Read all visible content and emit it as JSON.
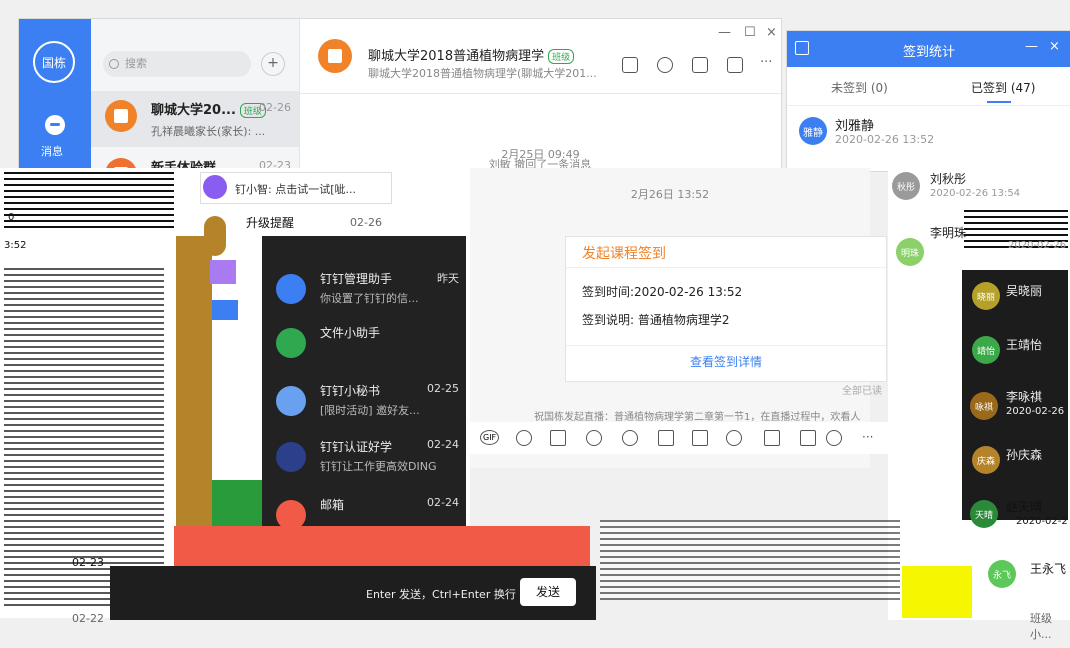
{
  "me": {
    "avatar_text": "国栋",
    "nav_label": "消息"
  },
  "search": {
    "placeholder": "搜索",
    "add": "+"
  },
  "conversations": [
    {
      "name": "聊城大学20...",
      "tag": "班级",
      "time": "02-26",
      "sub": "孔祥晨曦家长(家长): ..."
    },
    {
      "name": "新手体验群",
      "time": "02-23",
      "sub": ""
    }
  ],
  "chat": {
    "title": "聊城大学2018普通植物病理学",
    "tag": "班级",
    "subtitle": "聊城大学2018普通植物病理学(聊城大学201...",
    "sys_time_1": "2月25日 09:49",
    "sys_recall": "刘敏 撤回了一条消息",
    "sys_time_2": "2月26日 13:52",
    "window_min": "—",
    "window_max": "☐",
    "window_close": "×",
    "more": "···"
  },
  "stats": {
    "title": "签到统计",
    "tab_unsigned": "未签到 (0)",
    "tab_signed": "已签到 (47)",
    "min": "—",
    "close": "×",
    "people": [
      {
        "avatar": "雅静",
        "name": "刘雅静",
        "time": "2020-02-26 13:52"
      },
      {
        "avatar": "秋彤",
        "name": "刘秋彤",
        "time": "2020-02-26 13:54"
      },
      {
        "avatar": "明珠",
        "name": "李明珠",
        "time": "2020-02-26"
      }
    ]
  },
  "overlay": {
    "ding_tip": "钉小智: 点击试一试[呲...",
    "upgrade": "升级提醒",
    "upgrade_time": "02-26",
    "dark_items": [
      {
        "name": "钉钉管理助手",
        "time": "昨天",
        "sub": "你设置了钉钉的信..."
      },
      {
        "name": "文件小助手",
        "time": "",
        "sub": ""
      },
      {
        "name": "钉钉小秘书",
        "time": "02-25",
        "sub": "[限时活动] 邀好友..."
      },
      {
        "name": "钉钉认证好学",
        "time": "02-24",
        "sub": "钉钉让工作更高效DING"
      },
      {
        "name": "邮箱",
        "time": "02-24",
        "sub": ""
      }
    ],
    "left_time": "3:52",
    "left_date": "02-23",
    "left_date2": "02-22",
    "count": "0"
  },
  "card": {
    "title": "发起课程签到",
    "line1": "签到时间:2020-02-26 13:52",
    "line2": "签到说明: 普通植物病理学2",
    "link": "查看签到详情",
    "all_read": "全部已读",
    "live_note": "祝国栋发起直播：普通植物病理学第二章第一节1，在直播过程中，欢看人"
  },
  "composer": {
    "hint": "Enter 发送，Ctrl+Enter 换行",
    "send": "发送",
    "tool_gif": "GIF",
    "tool_more": "···"
  },
  "right_list": [
    {
      "avatar": "晓丽",
      "name": "吴晓丽"
    },
    {
      "avatar": "靖怡",
      "name": "王靖怡"
    },
    {
      "avatar": "咏祺",
      "name": "李咏祺",
      "time": "2020-02-26"
    },
    {
      "avatar": "庆森",
      "name": "孙庆森"
    },
    {
      "avatar": "天晴",
      "name": "赵天晴",
      "time": "2020-02-2"
    },
    {
      "avatar": "永飞",
      "name": "王永飞"
    },
    {
      "avatar": "",
      "name": "班级小..."
    }
  ],
  "colors": {
    "accent": "#3b7ff2",
    "orange": "#f0822a",
    "green": "#2fa84f",
    "red": "#f05a46"
  }
}
